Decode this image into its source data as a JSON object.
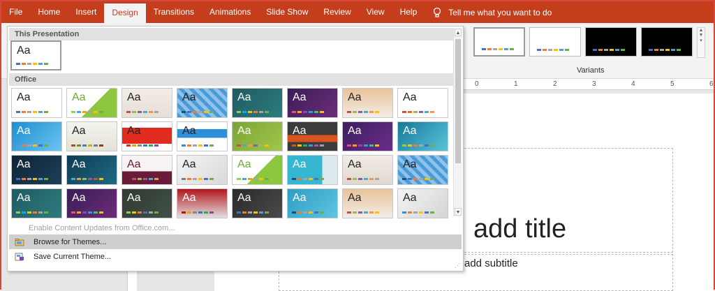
{
  "tabs": [
    "File",
    "Home",
    "Insert",
    "Design",
    "Transitions",
    "Animations",
    "Slide Show",
    "Review",
    "View",
    "Help"
  ],
  "active_tab": "Design",
  "tell_me": "Tell me what you want to do",
  "variants_label": "Variants",
  "ruler_labels": [
    "0",
    "1",
    "2",
    "3",
    "4",
    "5",
    "6"
  ],
  "section_this": "This Presentation",
  "section_office": "Office",
  "menu": {
    "enable_updates": "Enable Content Updates from Office.com...",
    "browse": "Browse for Themes...",
    "save": "Save Current Theme..."
  },
  "slide": {
    "title": "add title",
    "subtitle": "add subtitle"
  },
  "themes": [
    {
      "aa": "Aa",
      "bg": "#ffffff",
      "fg": "#222",
      "bars": [
        "#4472c4",
        "#ed7d31",
        "#a5a5a5",
        "#ffc000",
        "#5b9bd5",
        "#70ad47"
      ]
    },
    {
      "aa": "Aa",
      "bg": "linear-gradient(135deg,#fff 55%,#8dc63f 55%)",
      "fg": "#6ea93a",
      "bars": [
        "#92d050",
        "#4aa3df",
        "#f0a30a",
        "#a5a5a5",
        "#ffc000",
        "#70ad47"
      ]
    },
    {
      "aa": "Aa",
      "bg": "linear-gradient(180deg,#f2ece6,#e6dfd8)",
      "fg": "#222",
      "bars": [
        "#c0504d",
        "#9bbb59",
        "#8064a2",
        "#4bacc6",
        "#f79646",
        "#a5a5a5"
      ]
    },
    {
      "aa": "Aa",
      "bg": "repeating-linear-gradient(45deg,#4a9bd6 0 5px,#8fc3ea 5px 10px)",
      "fg": "#222",
      "bars": [
        "#1f4e79",
        "#4472c4",
        "#ed7d31",
        "#a5a5a5",
        "#ffc000",
        "#70ad47"
      ]
    },
    {
      "aa": "Aa",
      "bg": "linear-gradient(135deg,#1f5a61,#2d7c7f)",
      "fg": "#fff",
      "bars": [
        "#92d050",
        "#00b0f0",
        "#ffc000",
        "#ed7d31",
        "#a5a5a5",
        "#70ad47"
      ]
    },
    {
      "aa": "Aa",
      "bg": "linear-gradient(135deg,#3b1d54,#6b2d7a)",
      "fg": "#fff",
      "bars": [
        "#e84c8a",
        "#f7a21b",
        "#8e44ad",
        "#3498db",
        "#2ecc71",
        "#f1c40f"
      ]
    },
    {
      "aa": "Aa",
      "bg": "linear-gradient(180deg,#e9c39a,#f2ede7)",
      "fg": "#222",
      "bars": [
        "#c0504d",
        "#9bbb59",
        "#8064a2",
        "#4bacc6",
        "#f79646",
        "#ffc000"
      ]
    },
    {
      "aa": "Aa",
      "bg": "#ffffff",
      "fg": "#222",
      "bars": [
        "#c0504d",
        "#e46c0a",
        "#9bbb59",
        "#8064a2",
        "#4bacc6",
        "#f79646"
      ]
    },
    {
      "aa": "Aa",
      "bg": "linear-gradient(135deg,#1c8fd1,#6cc3ef)",
      "fg": "#fff",
      "bars": [
        "#5b9bd5",
        "#ed7d31",
        "#a5a5a5",
        "#ffc000",
        "#4472c4",
        "#70ad47"
      ]
    },
    {
      "aa": "Aa",
      "bg": "linear-gradient(180deg,#f4f4ef,#e2e2d6)",
      "fg": "#222",
      "bars": [
        "#a0522d",
        "#6b8e23",
        "#4682b4",
        "#daa520",
        "#708090",
        "#8b4513"
      ]
    },
    {
      "aa": "Aa",
      "bg": "linear-gradient(180deg,#ffffff 20%,#e02b1f 20%,#e02b1f 75%,#fff 75%)",
      "fg": "#222",
      "bars": [
        "#e02b1f",
        "#f39c12",
        "#7f8c8d",
        "#2980b9",
        "#27ae60",
        "#8e44ad"
      ]
    },
    {
      "aa": "Aa",
      "bg": "linear-gradient(180deg,#fff 25%,#2f8fd6 25%,#2f8fd6 55%,#fff 55%)",
      "fg": "#222",
      "bars": [
        "#2f8fd6",
        "#ed7d31",
        "#a5a5a5",
        "#ffc000",
        "#4472c4",
        "#70ad47"
      ]
    },
    {
      "aa": "Aa",
      "bg": "linear-gradient(135deg,#7aa533,#a2c64c)",
      "fg": "#fff",
      "bars": [
        "#c0504d",
        "#4bacc6",
        "#f79646",
        "#8064a2",
        "#9bbb59",
        "#ffc000"
      ]
    },
    {
      "aa": "Aa",
      "bg": "linear-gradient(180deg,#3b3b3b 45%,#d9531e 45%,#d9531e 70%,#3b3b3b 70%)",
      "fg": "#fff",
      "bars": [
        "#d9531e",
        "#f1c40f",
        "#27ae60",
        "#3498db",
        "#9b59b6",
        "#95a5a6"
      ]
    },
    {
      "aa": "Aa",
      "bg": "linear-gradient(135deg,#3c1f5e,#6d2c8a)",
      "fg": "#fff",
      "bars": [
        "#e84c8a",
        "#f7a21b",
        "#8e44ad",
        "#3498db",
        "#2ecc71",
        "#f1c40f"
      ]
    },
    {
      "aa": "Aa",
      "bg": "linear-gradient(135deg,#157a9a,#5cc2d9)",
      "fg": "#fff",
      "bars": [
        "#92d050",
        "#ffc000",
        "#ed7d31",
        "#a5a5a5",
        "#4472c4",
        "#70ad47"
      ]
    },
    {
      "aa": "Aa",
      "bg": "linear-gradient(135deg,#0f2436,#1d3e5a)",
      "fg": "#fff",
      "bars": [
        "#4472c4",
        "#ed7d31",
        "#a5a5a5",
        "#ffc000",
        "#5b9bd5",
        "#70ad47"
      ]
    },
    {
      "aa": "Aa",
      "bg": "linear-gradient(135deg,#0f3b52,#1f6a84)",
      "fg": "#fff",
      "bars": [
        "#4bacc6",
        "#f79646",
        "#9bbb59",
        "#8064a2",
        "#c0504d",
        "#ffc000"
      ]
    },
    {
      "aa": "Aa",
      "bg": "linear-gradient(180deg,#f7f2f4 55%,#6b1b3a 55%)",
      "fg": "#6b1b3a",
      "bars": [
        "#6b1b3a",
        "#c0504d",
        "#9bbb59",
        "#8064a2",
        "#4bacc6",
        "#f79646"
      ]
    },
    {
      "aa": "Aa",
      "bg": "linear-gradient(135deg,#f4f4f4,#d9d9d9)",
      "fg": "#222",
      "bars": [
        "#7f7f7f",
        "#ed7d31",
        "#a5a5a5",
        "#ffc000",
        "#4472c4",
        "#70ad47"
      ]
    },
    {
      "aa": "Aa",
      "bg": "linear-gradient(135deg,#fff 55%,#8dc63f 55%)",
      "fg": "#6ea93a",
      "bars": [
        "#92d050",
        "#4aa3df",
        "#f0a30a",
        "#a5a5a5",
        "#ffc000",
        "#70ad47"
      ]
    },
    {
      "aa": "Aa",
      "bg": "linear-gradient(90deg,#35b6d1 70%,#dbe8ec 70%)",
      "fg": "#fff",
      "bars": [
        "#1f4e79",
        "#ed7d31",
        "#a5a5a5",
        "#ffc000",
        "#4472c4",
        "#70ad47"
      ]
    },
    {
      "aa": "Aa",
      "bg": "linear-gradient(180deg,#f2ece6,#e0d8d0)",
      "fg": "#222",
      "bars": [
        "#c0504d",
        "#9bbb59",
        "#8064a2",
        "#4bacc6",
        "#f79646",
        "#a5a5a5"
      ]
    },
    {
      "aa": "Aa",
      "bg": "repeating-linear-gradient(45deg,#4a9bd6 0 5px,#8fc3ea 5px 10px)",
      "fg": "#222",
      "bars": [
        "#1f4e79",
        "#4472c4",
        "#ed7d31",
        "#a5a5a5",
        "#ffc000",
        "#70ad47"
      ]
    },
    {
      "aa": "Aa",
      "bg": "linear-gradient(135deg,#1f5a61,#2d7c7f)",
      "fg": "#fff",
      "bars": [
        "#92d050",
        "#00b0f0",
        "#ffc000",
        "#ed7d31",
        "#a5a5a5",
        "#70ad47"
      ]
    },
    {
      "aa": "Aa",
      "bg": "linear-gradient(135deg,#3b1d54,#6b2d7a)",
      "fg": "#fff",
      "bars": [
        "#e84c8a",
        "#f7a21b",
        "#8e44ad",
        "#3498db",
        "#2ecc71",
        "#f1c40f"
      ]
    },
    {
      "aa": "Aa",
      "bg": "linear-gradient(135deg,#2f3a33,#415046)",
      "fg": "#fff",
      "bars": [
        "#92d050",
        "#ffc000",
        "#ed7d31",
        "#4472c4",
        "#a5a5a5",
        "#70ad47"
      ]
    },
    {
      "aa": "Aa",
      "bg": "linear-gradient(180deg,#b3151d,#e0e0e0)",
      "fg": "#fff",
      "bars": [
        "#b3151d",
        "#f39c12",
        "#7f8c8d",
        "#2980b9",
        "#27ae60",
        "#8e44ad"
      ]
    },
    {
      "aa": "Aa",
      "bg": "linear-gradient(135deg,#2a2a2a,#4a4a4a)",
      "fg": "#fff",
      "bars": [
        "#4472c4",
        "#ed7d31",
        "#a5a5a5",
        "#ffc000",
        "#5b9bd5",
        "#70ad47"
      ]
    },
    {
      "aa": "Aa",
      "bg": "linear-gradient(135deg,#2e9ec4,#5fc4e0)",
      "fg": "#fff",
      "bars": [
        "#1f4e79",
        "#ed7d31",
        "#a5a5a5",
        "#ffc000",
        "#4472c4",
        "#70ad47"
      ]
    },
    {
      "aa": "Aa",
      "bg": "linear-gradient(180deg,#e9c39a,#f2ede7)",
      "fg": "#222",
      "bars": [
        "#c0504d",
        "#9bbb59",
        "#8064a2",
        "#4bacc6",
        "#f79646",
        "#ffc000"
      ]
    },
    {
      "aa": "Aa",
      "bg": "linear-gradient(135deg,#f4f4f4,#d5d5d5)",
      "fg": "#222",
      "bars": [
        "#2f8fd6",
        "#ed7d31",
        "#a5a5a5",
        "#ffc000",
        "#4472c4",
        "#70ad47"
      ]
    }
  ],
  "this_theme": {
    "aa": "Aa",
    "bars": [
      "#4472c4",
      "#ed7d31",
      "#a5a5a5",
      "#ffc000",
      "#5b9bd5",
      "#70ad47"
    ]
  },
  "variants": [
    {
      "bg": "#ffffff",
      "bars": [
        "#4472c4",
        "#ed7d31",
        "#a5a5a5",
        "#ffc000",
        "#5b9bd5",
        "#70ad47"
      ]
    },
    {
      "bg": "#ffffff",
      "bars": [
        "#4472c4",
        "#ed7d31",
        "#a5a5a5",
        "#ffc000",
        "#5b9bd5",
        "#70ad47"
      ]
    },
    {
      "bg": "#000000",
      "bars": [
        "#4472c4",
        "#ed7d31",
        "#a5a5a5",
        "#ffc000",
        "#5b9bd5",
        "#70ad47"
      ]
    },
    {
      "bg": "#000000",
      "bars": [
        "#4472c4",
        "#ed7d31",
        "#a5a5a5",
        "#ffc000",
        "#5b9bd5",
        "#70ad47"
      ]
    }
  ]
}
